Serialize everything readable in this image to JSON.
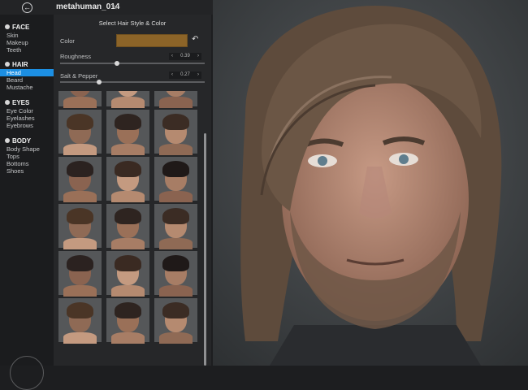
{
  "header": {
    "title": "metahuman_014"
  },
  "sidebar": {
    "groups": [
      {
        "label": "FACE",
        "items": [
          "Skin",
          "Makeup",
          "Teeth"
        ]
      },
      {
        "label": "HAIR",
        "items": [
          "Head",
          "Beard",
          "Mustache"
        ]
      },
      {
        "label": "EYES",
        "items": [
          "Eye Color",
          "Eyelashes",
          "Eyebrows"
        ]
      },
      {
        "label": "BODY",
        "items": [
          "Body Shape",
          "Tops",
          "Bottoms",
          "Shoes"
        ]
      }
    ],
    "active_item": "Head"
  },
  "panel": {
    "title": "Select Hair Style & Color",
    "color_label": "Color",
    "color_value": "#8c6428",
    "roughness": {
      "label": "Roughness",
      "value": "0.39"
    },
    "salt_pepper": {
      "label": "Salt & Pepper",
      "value": "0.27"
    },
    "tile_count": 18
  },
  "colors": {
    "accent": "#1c8fe3"
  }
}
